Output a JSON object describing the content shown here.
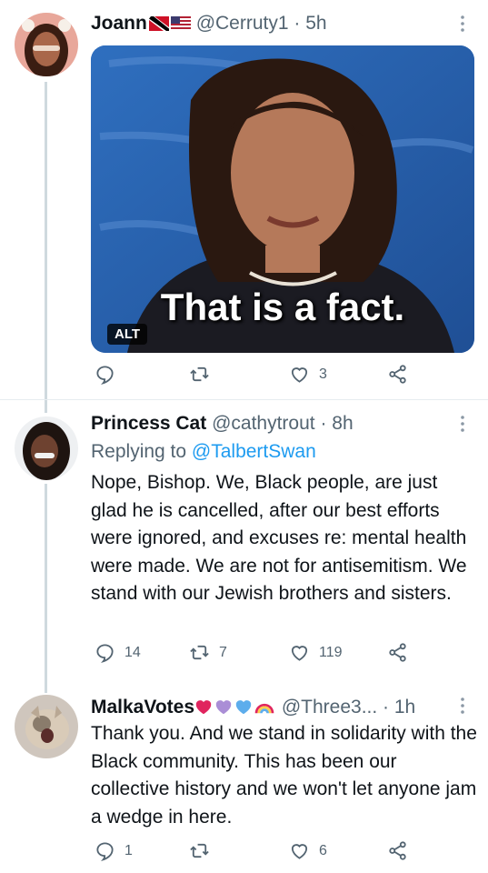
{
  "tweets": [
    {
      "name": "Joann",
      "handle": "@Cerruty1",
      "time": "5h",
      "media": {
        "caption": "That is a fact.",
        "alt_badge": "ALT"
      },
      "reply_count": "",
      "retweet_count": "",
      "like_count": "3"
    },
    {
      "name": "Princess Cat",
      "handle": "@cathytrout",
      "time": "8h",
      "replying_prefix": "Replying to ",
      "replying_to": "@TalbertSwan",
      "text": "Nope, Bishop. We, Black people, are just glad he is cancelled, after our best efforts were ignored, and excuses re: mental health were made. We are not for antisemitism. We stand with our Jewish brothers and sisters.",
      "reply_count": "14",
      "retweet_count": "7",
      "like_count": "119"
    },
    {
      "name": "MalkaVotes",
      "handle": "@Three3...",
      "time": "1h",
      "text": "Thank you. And we stand in solidarity with the Black community. This has been our collective history and we won't let anyone jam a wedge in here.",
      "reply_count": "1",
      "retweet_count": "",
      "like_count": "6"
    }
  ],
  "separator": " · ",
  "icons": [
    "reply-icon",
    "retweet-icon",
    "like-icon",
    "share-icon",
    "more-icon"
  ],
  "colors": {
    "link": "#1d9bf0",
    "secondary": "#536471",
    "text": "#0f1419",
    "thread_line": "#cfd9de"
  }
}
